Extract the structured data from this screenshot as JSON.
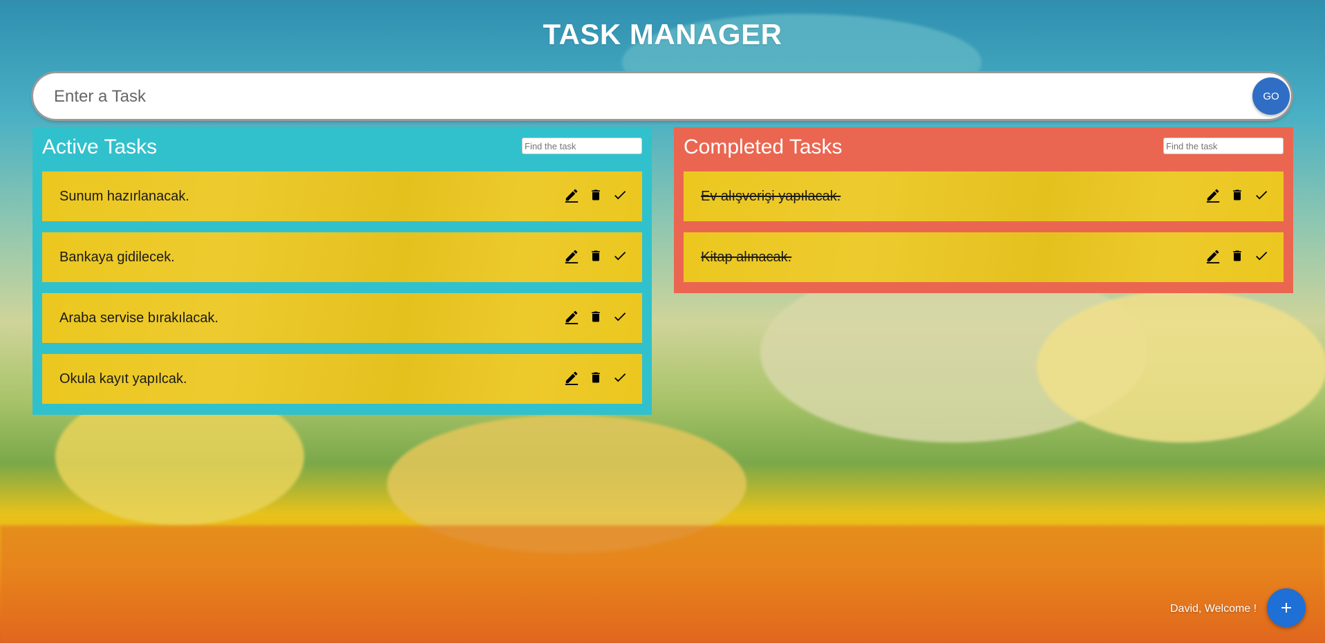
{
  "app": {
    "title": "TASK MANAGER"
  },
  "new_task": {
    "placeholder": "Enter a Task",
    "go_label": "GO"
  },
  "active": {
    "title": "Active Tasks",
    "search_placeholder": "Find the task",
    "tasks": [
      {
        "text": "Sunum hazırlanacak."
      },
      {
        "text": "Bankaya gidilecek."
      },
      {
        "text": "Araba servise bırakılacak."
      },
      {
        "text": "Okula kayıt yapılcak."
      }
    ]
  },
  "completed": {
    "title": "Completed Tasks",
    "search_placeholder": "Find the task",
    "tasks": [
      {
        "text": "Ev alışverişi yapılacak."
      },
      {
        "text": "Kitap alınacak."
      }
    ]
  },
  "footer": {
    "welcome": "David, Welcome !",
    "fab_label": "+"
  },
  "colors": {
    "active_panel": "#31c1cd",
    "completed_panel": "#eb6650",
    "task_item": "#ecc71f",
    "go_button": "#2f6ec4",
    "fab": "#1e6fd6"
  },
  "icons": [
    "pencil-icon",
    "trash-icon",
    "check-icon"
  ]
}
